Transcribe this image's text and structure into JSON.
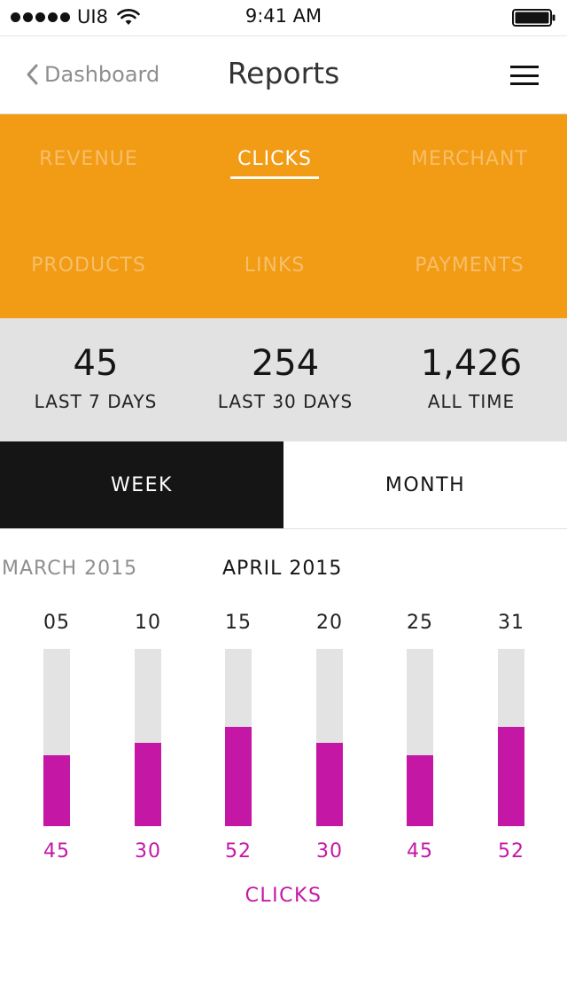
{
  "status_bar": {
    "carrier": "UI8",
    "time": "9:41 AM",
    "signal_icon": "signal-dots-icon",
    "wifi_icon": "wifi-icon",
    "battery_icon": "battery-icon"
  },
  "nav": {
    "back_label": "Dashboard",
    "title": "Reports",
    "back_icon": "chevron-left-icon",
    "menu_icon": "hamburger-menu-icon"
  },
  "categories": {
    "accent_color": "#f29b15",
    "items": [
      {
        "label": "REVENUE",
        "active": false
      },
      {
        "label": "CLICKS",
        "active": true
      },
      {
        "label": "MERCHANT",
        "active": false
      },
      {
        "label": "PRODUCTS",
        "active": false
      },
      {
        "label": "LINKS",
        "active": false
      },
      {
        "label": "PAYMENTS",
        "active": false
      }
    ]
  },
  "stats": [
    {
      "value": "45",
      "label": "LAST 7 DAYS"
    },
    {
      "value": "254",
      "label": "LAST 30 DAYS"
    },
    {
      "value": "1,426",
      "label": "ALL TIME"
    }
  ],
  "period_toggle": {
    "week_label": "WEEK",
    "month_label": "MONTH",
    "selected": "WEEK"
  },
  "months": {
    "previous": "MARCH 2015",
    "current": "APRIL 2015"
  },
  "chart_data": {
    "type": "bar",
    "categories": [
      "05",
      "10",
      "15",
      "20",
      "25",
      "31"
    ],
    "values": [
      45,
      30,
      52,
      30,
      45,
      52
    ],
    "series": [
      {
        "name": "CLICKS",
        "values": [
          45,
          30,
          52,
          30,
          45,
          52
        ],
        "fill_fraction": [
          0.4,
          0.47,
          0.56,
          0.47,
          0.4,
          0.56
        ]
      }
    ],
    "legend": "CLICKS",
    "bar_color": "#c517a6",
    "track_color": "#e3e3e3",
    "grid": false
  }
}
